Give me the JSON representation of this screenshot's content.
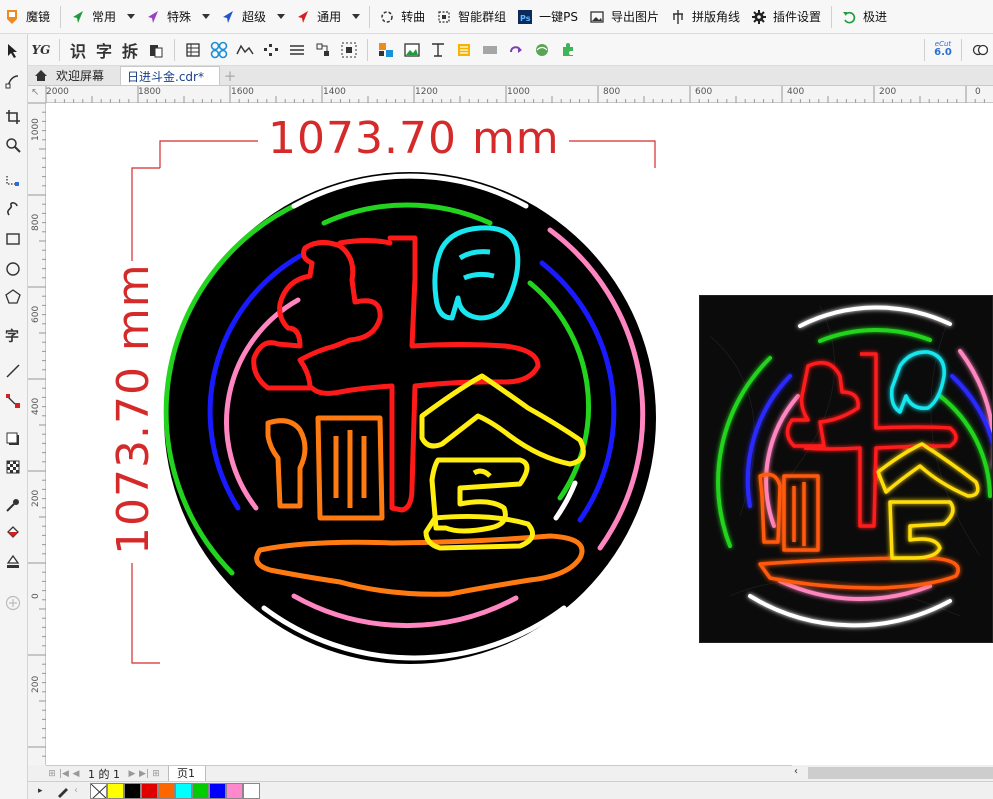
{
  "plugin_bar": {
    "app_label": "魔镜",
    "items": [
      {
        "label": "常用",
        "icon": "arrow-cursor-icon",
        "dropdown": true,
        "color": "#1e9c3c"
      },
      {
        "label": "特殊",
        "icon": "arrow-cursor-icon",
        "dropdown": true,
        "color": "#9b3fc4"
      },
      {
        "label": "超级",
        "icon": "arrow-cursor-icon",
        "dropdown": true,
        "color": "#2553c9"
      },
      {
        "label": "通用",
        "icon": "arrow-cursor-icon",
        "dropdown": true,
        "color": "#d42020"
      },
      {
        "label": "转曲",
        "icon": "convert-curve-icon",
        "dropdown": false
      },
      {
        "label": "智能群组",
        "icon": "smart-group-icon",
        "dropdown": false
      },
      {
        "label": "一键PS",
        "icon": "photoshop-icon",
        "dropdown": false
      },
      {
        "label": "导出图片",
        "icon": "export-image-icon",
        "dropdown": false
      },
      {
        "label": "拼版角线",
        "icon": "crop-marks-icon",
        "dropdown": false
      },
      {
        "label": "插件设置",
        "icon": "gear-icon",
        "dropdown": false
      },
      {
        "label": "极进",
        "icon": "undo-icon",
        "dropdown": false
      }
    ]
  },
  "toolbar2": {
    "text_buttons": [
      "YG",
      "识",
      "字",
      "拆"
    ],
    "ecut_label_top": "eCut",
    "ecut_label_bottom": "6.0"
  },
  "tabs": {
    "welcome": "欢迎屏幕",
    "document": "日进斗金.cdr*",
    "add": "+"
  },
  "ruler": {
    "h_labels": [
      "2000",
      "1800",
      "1600",
      "1400",
      "1200",
      "1000",
      "800",
      "600",
      "400",
      "200",
      "0"
    ],
    "v_labels": [
      "1000",
      "800",
      "600",
      "400",
      "200",
      "0",
      "200"
    ],
    "corner": "↖"
  },
  "design": {
    "width_dimension": "1073.70 mm",
    "height_dimension": "1073.70 mm",
    "dimension_color": "#d42a2a"
  },
  "page_nav": {
    "counter": "1 的 1",
    "page_tab": "页1"
  },
  "palette": {
    "colors": [
      "#ffff00",
      "#000000",
      "#e00000",
      "#ff6600",
      "#00ffff",
      "#00cc00",
      "#0000ff",
      "#ff88cc",
      "#ffffff"
    ]
  }
}
